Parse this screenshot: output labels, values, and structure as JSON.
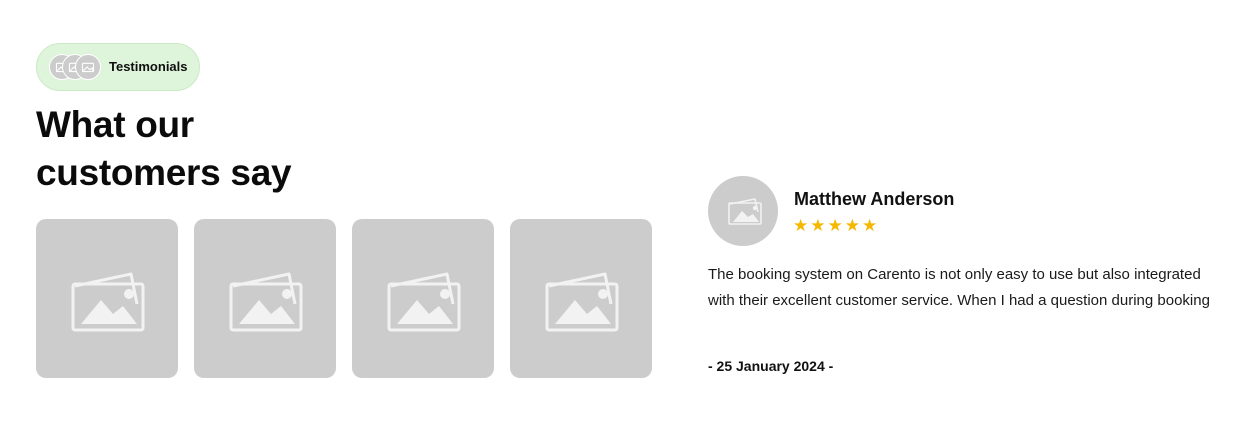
{
  "badge": {
    "label": "Testimonials",
    "avatars": [
      "avatar-placeholder-icon",
      "avatar-placeholder-icon",
      "avatar-placeholder-icon"
    ]
  },
  "heading": {
    "line1": "What our",
    "line2": "customers say"
  },
  "gallery": {
    "items": [
      "image-placeholder-icon",
      "image-placeholder-icon",
      "image-placeholder-icon",
      "image-placeholder-icon"
    ]
  },
  "testimonial": {
    "name": "Matthew Anderson",
    "rating": 5,
    "rating_max": 5,
    "star_glyph": "★",
    "quote": "The booking system on Carento is not only easy to use but also integrated with their excellent customer service. When I had a question during booking",
    "date": "- 25 January 2024 -"
  },
  "colors": {
    "badge_bg": "#dff5db",
    "placeholder": "#cccccc",
    "star": "#f5b800",
    "text": "#101010"
  }
}
